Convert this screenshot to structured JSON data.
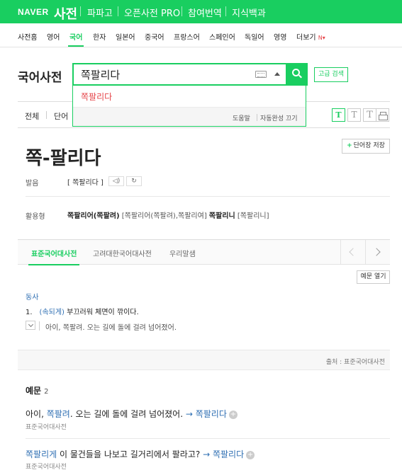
{
  "topbar": {
    "logo": "NAVER",
    "title": "사전",
    "nav": [
      "파파고",
      "오픈사전 PRO",
      "참여번역",
      "지식백과"
    ]
  },
  "subnav": {
    "items": [
      "사전홈",
      "영어",
      "국어",
      "한자",
      "일본어",
      "중국어",
      "프랑스어",
      "스페인어",
      "독일어",
      "영영",
      "더보기"
    ],
    "new_badge": "N",
    "active": "국어"
  },
  "search": {
    "dict_title": "국어사전",
    "query": "쪽팔리다",
    "advanced_label": "고급 검색"
  },
  "autocomplete": {
    "suggestion": "쪽팔리다",
    "help": "도움말",
    "toggle": "자동완성 끄기"
  },
  "filters": {
    "items": [
      "전체",
      "단어"
    ],
    "font_sizes": [
      "T",
      "T",
      "T"
    ]
  },
  "entry": {
    "word": "쪽-팔리다",
    "save_label": "단어장 저장",
    "pron_label": "발음",
    "pron_value": "[ 쪽팔리다 ]",
    "conj_label": "활용형",
    "conj_1": "쪽팔리어(쪽팔려)",
    "conj_1_pron": "[쪽팔리어(쪽팔려),쪽팔리여]",
    "conj_2": "쪽팔리니",
    "conj_2_pron": "[쪽팔리니]"
  },
  "tabs": [
    "표준국어대사전",
    "고려대한국어대사전",
    "우리말샘"
  ],
  "meaning": {
    "open_examples": "예문 열기",
    "pos": "동사",
    "num": "1.",
    "tag": "(속되게)",
    "definition": "부끄러워 체면이 깎이다.",
    "example": "아이, 쪽팔려. 오는 길에 돌에 걸려 넘어졌어.",
    "source": "출처 : 표준국어대사전"
  },
  "examples": {
    "heading": "예문",
    "count": "2",
    "items": [
      {
        "pre": "아이, ",
        "hl": "쪽팔려",
        "post": ". 오는 길에 돌에 걸려 넘어졌어.",
        "link": "→ 쪽팔리다",
        "source": "표준국어대사전"
      },
      {
        "pre": "",
        "hl": "쪽팔리게",
        "post": " 이 물건들을 나보고 길거리에서 팔라고?",
        "link": "→ 쪽팔리다",
        "source": "표준국어대사전"
      }
    ]
  },
  "colors": {
    "brand": "#19ce60",
    "link": "#2f6fb3",
    "highlight": "#e6454a"
  }
}
